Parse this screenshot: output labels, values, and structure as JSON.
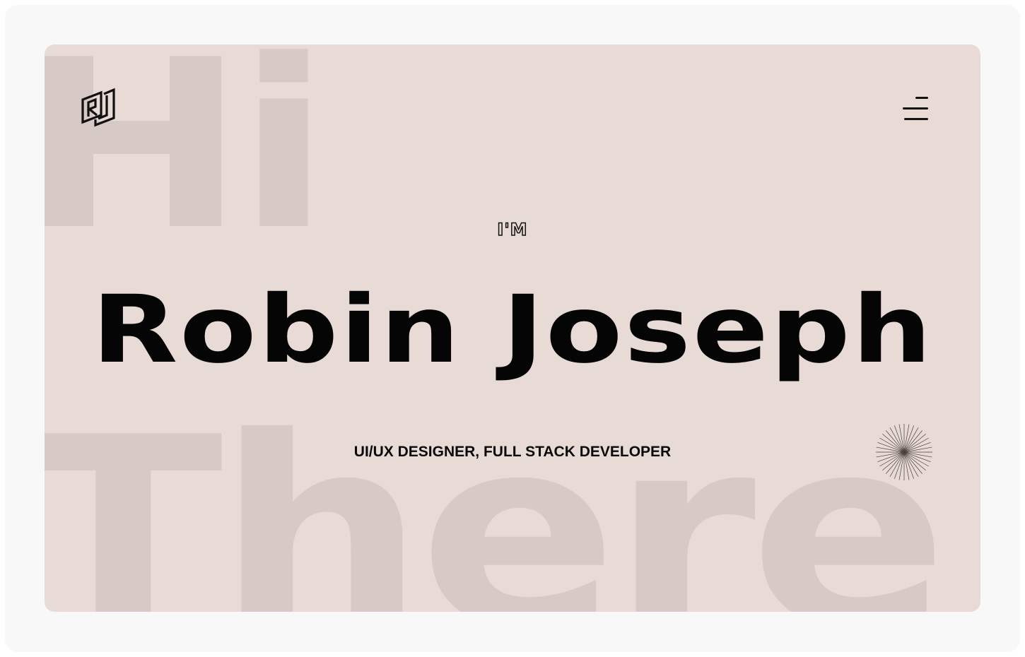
{
  "background_words": {
    "top": "Hi",
    "bottom": "There"
  },
  "header": {
    "logo_icon": "rj-monogram-logo",
    "menu_icon": "hamburger-menu-icon"
  },
  "hero": {
    "intro": "I'M",
    "name": "Robin Joseph",
    "role": "UI/UX DESIGNER, FULL STACK DEVELOPER"
  },
  "decoration": {
    "burst_icon": "starburst-icon"
  },
  "colors": {
    "page_background": "#f8f8f8",
    "card_background": "#e8dad4",
    "background_word": "#d6c9c6",
    "text": "#050505"
  }
}
